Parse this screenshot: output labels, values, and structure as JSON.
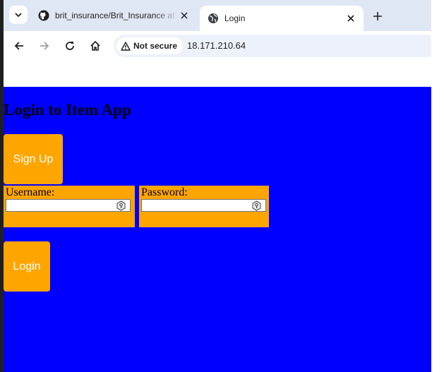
{
  "browser": {
    "tabs": [
      {
        "title": "brit_insurance/Brit_Insurance at",
        "icon": "github-icon",
        "active": false
      },
      {
        "title": "Login",
        "icon": "globe-icon",
        "active": true
      }
    ],
    "security_chip": "Not secure",
    "url": "18.171.210.64"
  },
  "page": {
    "heading": "Login to Item App",
    "signup_label": "Sign Up",
    "username_label": "Username:",
    "password_label": "Password:",
    "username_value": "",
    "password_value": "",
    "login_label": "Login",
    "background_color": "#0000ff",
    "accent_color": "#ffa500"
  }
}
